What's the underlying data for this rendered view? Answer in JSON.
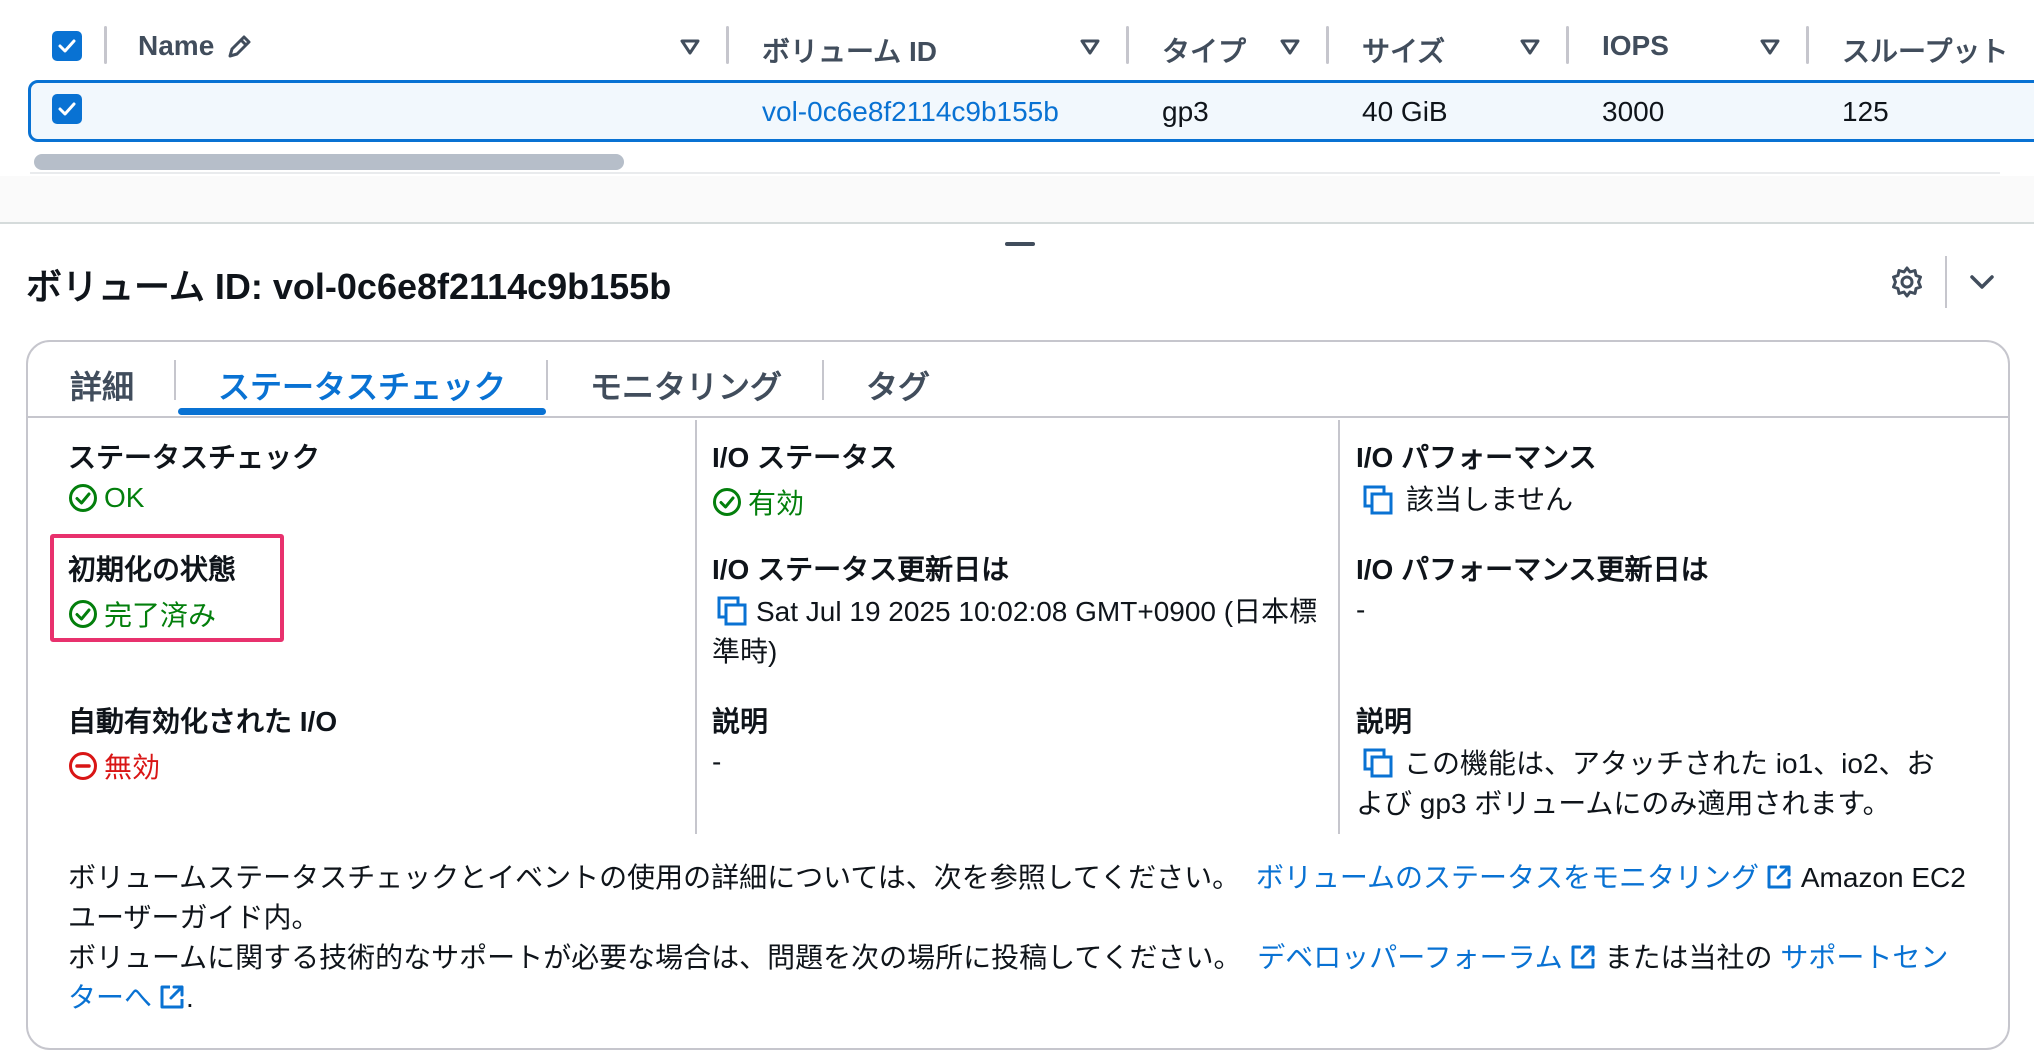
{
  "table": {
    "columns": [
      {
        "label": "Name",
        "has_edit_icon": true
      },
      {
        "label": "ボリューム ID"
      },
      {
        "label": "タイプ"
      },
      {
        "label": "サイズ"
      },
      {
        "label": "IOPS"
      },
      {
        "label": "スループット"
      }
    ],
    "selected_row": {
      "checked": true,
      "name": "",
      "volume_id": "vol-0c6e8f2114c9b155b",
      "type": "gp3",
      "size": "40 GiB",
      "iops": "3000",
      "throughput": "125"
    }
  },
  "panel": {
    "title": "ボリューム ID: vol-0c6e8f2114c9b155b",
    "tabs": [
      {
        "label": "詳細",
        "active": false
      },
      {
        "label": "ステータスチェック",
        "active": true
      },
      {
        "label": "モニタリング",
        "active": false
      },
      {
        "label": "タグ",
        "active": false
      }
    ],
    "fields": {
      "status_check": {
        "label": "ステータスチェック",
        "value": "OK",
        "state": "success"
      },
      "init_state": {
        "label": "初期化の状態",
        "value": "完了済み",
        "state": "success"
      },
      "auto_enabled_io": {
        "label": "自動有効化された I/O",
        "value": "無効",
        "state": "error"
      },
      "io_status": {
        "label": "I/O ステータス",
        "value": "有効",
        "state": "success"
      },
      "io_status_updated": {
        "label": "I/O ステータス更新日は",
        "value": "Sat Jul 19 2025 10:02:08 GMT+0900 (日本標準時)"
      },
      "description_mid": {
        "label": "説明",
        "value": "-"
      },
      "io_performance": {
        "label": "I/O パフォーマンス",
        "value": "該当しません"
      },
      "io_performance_updated": {
        "label": "I/O パフォーマンス更新日は",
        "value": "-"
      },
      "description_right": {
        "label": "説明",
        "value": "この機能は、アタッチされた io1、io2、および gp3 ボリュームにのみ適用されます。"
      }
    },
    "footer": {
      "line1_text": "ボリュームステータスチェックとイベントの使用の詳細については、次を参照してください。",
      "line1_link": "ボリュームのステータスをモニタリング",
      "line1_suffix": "Amazon EC2 ユーザーガイド内。",
      "line2_text": "ボリュームに関する技術的なサポートが必要な場合は、問題を次の場所に投稿してください。",
      "line2_link1": "デベロッパーフォーラム",
      "line2_mid": "または当社の",
      "line2_link2": "サポートセンターへ",
      "line2_end": "."
    }
  },
  "colors": {
    "accent": "#0972d3",
    "success": "#037f0c",
    "error": "#d91515",
    "highlight": "#e8316d"
  },
  "icons": {
    "edit": "pencil-icon",
    "sort": "caret-down-icon",
    "settings": "gear-icon",
    "collapse": "chevron-down-icon",
    "success": "check-circle-icon",
    "error": "minus-circle-icon",
    "copy": "copy-icon",
    "external": "external-link-icon"
  }
}
